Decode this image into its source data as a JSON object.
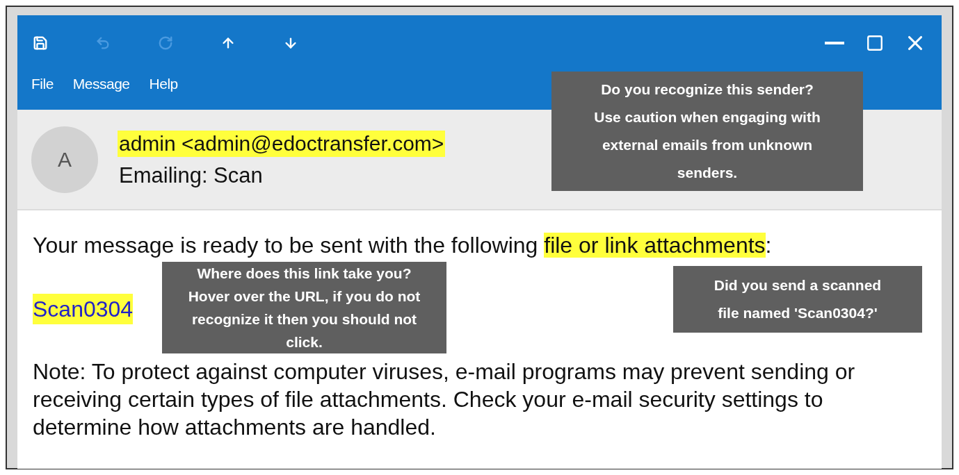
{
  "toolbar": [
    {
      "kind": "save",
      "disabled": false
    },
    {
      "kind": "undo",
      "disabled": true
    },
    {
      "kind": "redo",
      "disabled": true
    },
    {
      "kind": "up",
      "disabled": false
    },
    {
      "kind": "down",
      "disabled": false
    }
  ],
  "window_controls": [
    {
      "kind": "minimize"
    },
    {
      "kind": "maximize"
    },
    {
      "kind": "close"
    }
  ],
  "menu": [
    "File",
    "Message",
    "Help"
  ],
  "header": {
    "avatar": "A",
    "sender": "admin <admin@edoctransfer.com>",
    "sender_highlighted": true,
    "subject": "Emailing: Scan"
  },
  "body": {
    "intro": [
      {
        "text": "Your message is ready to be sent with the following ",
        "highlighted": false
      },
      {
        "text": "file or link attachments",
        "highlighted": true
      },
      {
        "text": ":",
        "highlighted": false
      }
    ],
    "link": "Scan0304",
    "link_highlighted": true,
    "note": "Note: To protect against computer viruses, e-mail programs may prevent sending or receiving certain types of file attachments. Check your e-mail security settings to determine how attachments are handled."
  },
  "callouts": [
    {
      "kind": "sender",
      "text": "Do you recognize this sender? Use caution when engaging with external emails from unknown senders."
    },
    {
      "kind": "link",
      "text": "Where does this link take you? Hover over the URL, if you do not recognize it then you should not click."
    },
    {
      "kind": "file",
      "text": "Did you send a scanned file named 'Scan0304?'"
    }
  ]
}
